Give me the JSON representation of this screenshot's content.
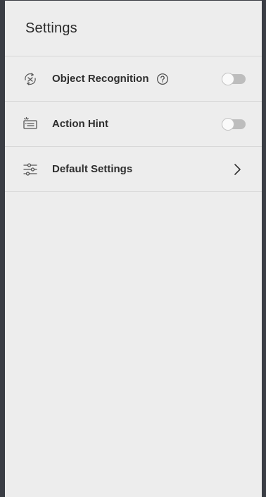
{
  "header": {
    "title": "Settings"
  },
  "rows": [
    {
      "label": "Object Recognition",
      "icon": "object-recognition-icon",
      "has_help": true,
      "control": "toggle",
      "toggle_on": false
    },
    {
      "label": "Action Hint",
      "icon": "action-hint-icon",
      "has_help": false,
      "control": "toggle",
      "toggle_on": false
    },
    {
      "label": "Default Settings",
      "icon": "sliders-icon",
      "has_help": false,
      "control": "chevron"
    }
  ],
  "colors": {
    "background": "#ededed",
    "divider": "#d8d8d8",
    "toggle_track_off": "#bdbdbd",
    "toggle_knob": "#fafafa",
    "text": "#2e2e2e",
    "frame": "#3a3d44"
  }
}
